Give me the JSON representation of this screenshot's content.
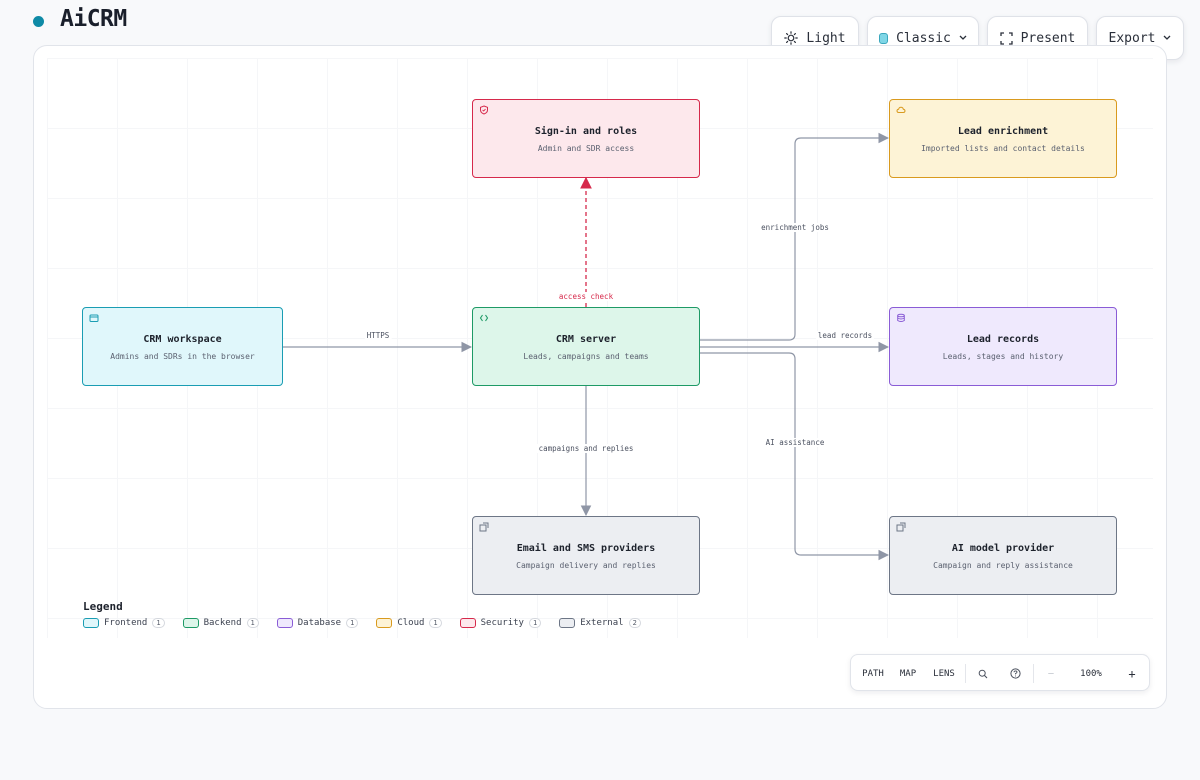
{
  "app": {
    "title": "AiCRM"
  },
  "toolbar": {
    "theme_label": "Light",
    "style_label": "Classic",
    "present_label": "Present",
    "export_label": "Export"
  },
  "diagram": {
    "nodes": {
      "security": {
        "title": "Sign-in and roles",
        "subtitle": "Admin and SDR access"
      },
      "cloud": {
        "title": "Lead enrichment",
        "subtitle": "Imported lists and contact details"
      },
      "frontend": {
        "title": "CRM workspace",
        "subtitle": "Admins and SDRs in the browser"
      },
      "backend": {
        "title": "CRM server",
        "subtitle": "Leads, campaigns and teams"
      },
      "database": {
        "title": "Lead records",
        "subtitle": "Leads, stages and history"
      },
      "email": {
        "title": "Email and SMS providers",
        "subtitle": "Campaign delivery and replies"
      },
      "ai": {
        "title": "AI model provider",
        "subtitle": "Campaign and reply assistance"
      }
    },
    "edges": {
      "https": "HTTPS",
      "access_check": "access check",
      "enrichment_jobs": "enrichment jobs",
      "lead_records": "lead records",
      "ai_assistance": "AI assistance",
      "campaigns_replies": "campaigns and replies"
    }
  },
  "legend": {
    "title": "Legend",
    "items": [
      {
        "label": "Frontend",
        "count": "1"
      },
      {
        "label": "Backend",
        "count": "1"
      },
      {
        "label": "Database",
        "count": "1"
      },
      {
        "label": "Cloud",
        "count": "1"
      },
      {
        "label": "Security",
        "count": "1"
      },
      {
        "label": "External",
        "count": "2"
      }
    ]
  },
  "controls": {
    "path_label": "PATH",
    "map_label": "MAP",
    "lens_label": "LENS",
    "minus_label": "—",
    "zoom_label": "100%",
    "plus_label": "+"
  },
  "colors": {
    "accent": "#0e8aa6",
    "frontend": "#1a9db3",
    "backend": "#1e9a66",
    "database": "#8a5cd6",
    "cloud": "#d99a1e",
    "security": "#d6294b",
    "external": "#6d7686",
    "edge": "#8f96a6"
  }
}
